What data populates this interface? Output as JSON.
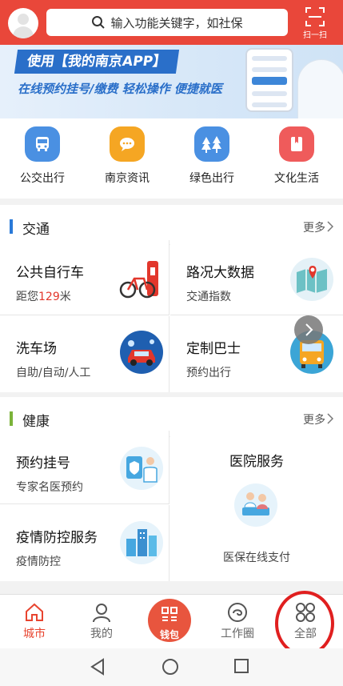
{
  "search": {
    "placeholder": "输入功能关键字，如社保"
  },
  "scan": {
    "label": "扫一扫"
  },
  "banner": {
    "title": "使用【我的南京APP】",
    "subtitle": "在线预约挂号/缴费 轻松操作 便捷就医"
  },
  "quick_items": [
    {
      "label": "公交出行",
      "color": "#4a90e2",
      "icon": "bus-icon"
    },
    {
      "label": "南京资讯",
      "color": "#f5a623",
      "icon": "chat-icon"
    },
    {
      "label": "绿色出行",
      "color": "#4a90e2",
      "icon": "tree-icon"
    },
    {
      "label": "文化生活",
      "color": "#ef5b5b",
      "icon": "book-icon"
    }
  ],
  "traffic": {
    "title": "交通",
    "more": "更多",
    "accent": "#2a7ad8",
    "cards": [
      {
        "title": "公共自行车",
        "sub_prefix": "距您",
        "sub_value": "129",
        "sub_suffix": "米",
        "icon": "bicycle-icon"
      },
      {
        "title": "路况大数据",
        "sub": "交通指数",
        "icon": "map-icon"
      },
      {
        "title": "洗车场",
        "sub": "自助/自动/人工",
        "icon": "car-wash-icon"
      },
      {
        "title": "定制巴士",
        "sub": "预约出行",
        "icon": "bus-icon"
      }
    ]
  },
  "health": {
    "title": "健康",
    "more": "更多",
    "accent": "#7bb33a",
    "cards": [
      {
        "title": "预约挂号",
        "sub": "专家名医预约",
        "icon": "doctor-icon"
      },
      {
        "title": "医院服务",
        "sub": "医保在线支付",
        "icon": "hospital-service-icon"
      },
      {
        "title": "疫情防控服务",
        "sub": "疫情防控",
        "icon": "city-icon"
      }
    ]
  },
  "nav": {
    "items": [
      {
        "label": "城市",
        "icon": "home-icon",
        "active": true
      },
      {
        "label": "我的",
        "icon": "person-icon",
        "active": false
      },
      {
        "label": "工作圈",
        "icon": "workcircle-icon",
        "active": false
      },
      {
        "label": "全部",
        "icon": "grid-icon",
        "active": false
      }
    ],
    "wallet_label": "钱包",
    "active_color": "#e8442f"
  }
}
